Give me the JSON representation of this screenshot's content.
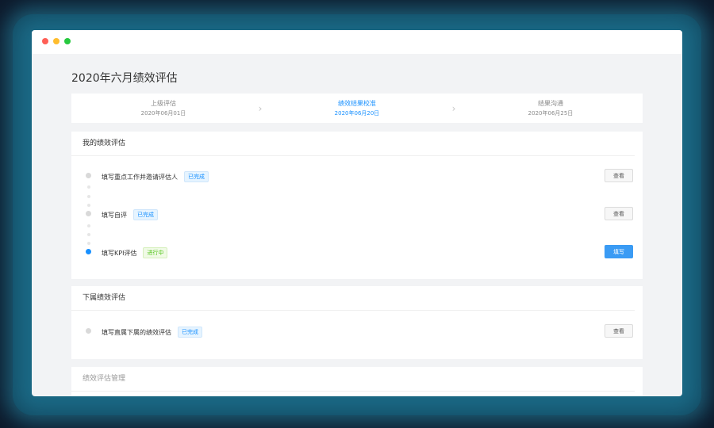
{
  "page": {
    "title": "2020年六月绩效评估"
  },
  "window_controls": {
    "close_color": "#ff5f56",
    "minimize_color": "#ffbd2e",
    "maximize_color": "#27c93f"
  },
  "steps": [
    {
      "name": "上级评估",
      "date": "2020年06月01日",
      "active": false
    },
    {
      "name": "绩效结果校准",
      "date": "2020年06月20日",
      "active": true
    },
    {
      "name": "结果沟通",
      "date": "2020年06月25日",
      "active": false
    }
  ],
  "my_review": {
    "title": "我的绩效评估",
    "items": [
      {
        "label": "填写重点工作并邀请评估人",
        "status": "已完成",
        "button": "查看",
        "state": "done"
      },
      {
        "label": "填写自评",
        "status": "已完成",
        "button": "查看",
        "state": "done"
      },
      {
        "label": "填写KPI评估",
        "status": "进行中",
        "button": "填写",
        "state": "active"
      }
    ]
  },
  "subordinate_review": {
    "title": "下属绩效评估",
    "items": [
      {
        "label": "填写直属下属的绩效评估",
        "status": "已完成",
        "button": "查看",
        "state": "done"
      }
    ]
  },
  "management": {
    "title": "绩效评估管理"
  },
  "colors": {
    "accent": "#1890ff",
    "success": "#52c41a",
    "background": "#f2f3f5"
  }
}
